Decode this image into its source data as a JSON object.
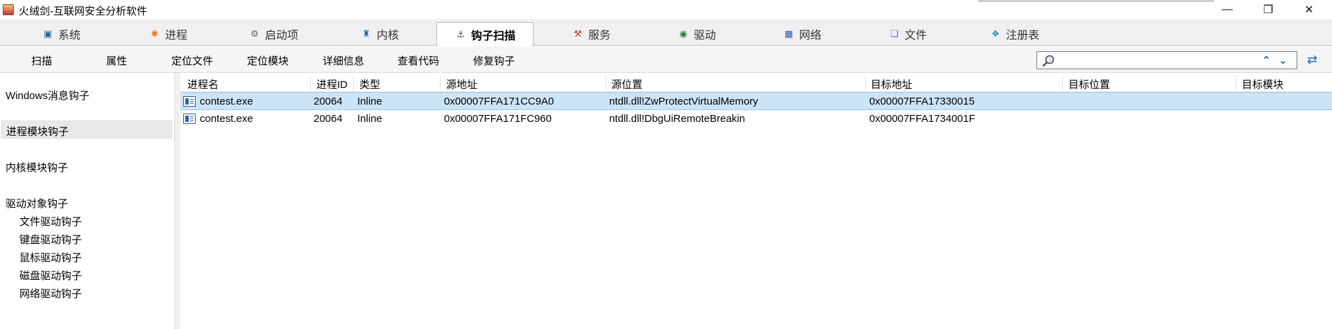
{
  "window": {
    "title": "火绒剑-互联网安全分析软件",
    "controls": {
      "minimize": "—",
      "maximize": "❐",
      "close": "✕"
    }
  },
  "tabs": [
    {
      "label": "系统",
      "icon": "monitor-icon",
      "glyph": "▣"
    },
    {
      "label": "进程",
      "icon": "windows-flag-icon",
      "glyph": "✱"
    },
    {
      "label": "启动项",
      "icon": "gear-icon",
      "glyph": "⚙"
    },
    {
      "label": "内核",
      "icon": "kernel-icon",
      "glyph": "♜"
    },
    {
      "label": "钩子扫描",
      "icon": "hook-icon",
      "glyph": "⚓",
      "active": true
    },
    {
      "label": "服务",
      "icon": "services-icon",
      "glyph": "⚒"
    },
    {
      "label": "驱动",
      "icon": "driver-icon",
      "glyph": "◉"
    },
    {
      "label": "网络",
      "icon": "network-icon",
      "glyph": "▦"
    },
    {
      "label": "文件",
      "icon": "file-icon",
      "glyph": "❏"
    },
    {
      "label": "注册表",
      "icon": "registry-icon",
      "glyph": "❖"
    }
  ],
  "toolbar": {
    "buttons": [
      "扫描",
      "属性",
      "定位文件",
      "定位模块",
      "详细信息",
      "查看代码",
      "修复钩子"
    ],
    "search": {
      "value": "",
      "placeholder": ""
    }
  },
  "sidebar": {
    "items": [
      {
        "label": "Windows消息钩子",
        "selected": false
      },
      {
        "label": "进程模块钩子",
        "selected": true
      },
      {
        "label": "内核模块钩子",
        "selected": false
      },
      {
        "label": "驱动对象钩子",
        "selected": false
      }
    ],
    "driver_sub_items": [
      "文件驱动钩子",
      "键盘驱动钩子",
      "鼠标驱动钩子",
      "磁盘驱动钩子",
      "网络驱动钩子"
    ]
  },
  "table": {
    "columns": [
      "进程名",
      "进程ID",
      "类型",
      "源地址",
      "源位置",
      "目标地址",
      "目标位置",
      "目标模块"
    ],
    "rows": [
      {
        "process": "contest.exe",
        "pid": "20064",
        "type": "Inline",
        "src_addr": "0x00007FFA171CC9A0",
        "src_loc": "ntdll.dll!ZwProtectVirtualMemory",
        "dst_addr": "0x00007FFA17330015",
        "dst_loc": "",
        "dst_module": "",
        "selected": true
      },
      {
        "process": "contest.exe",
        "pid": "20064",
        "type": "Inline",
        "src_addr": "0x00007FFA171FC960",
        "src_loc": "ntdll.dll!DbgUiRemoteBreakin",
        "dst_addr": "0x00007FFA1734001F",
        "dst_loc": "",
        "dst_module": "",
        "selected": false
      }
    ]
  },
  "colors": {
    "selection": "#cce4f7",
    "accent": "#1c4fa8"
  }
}
